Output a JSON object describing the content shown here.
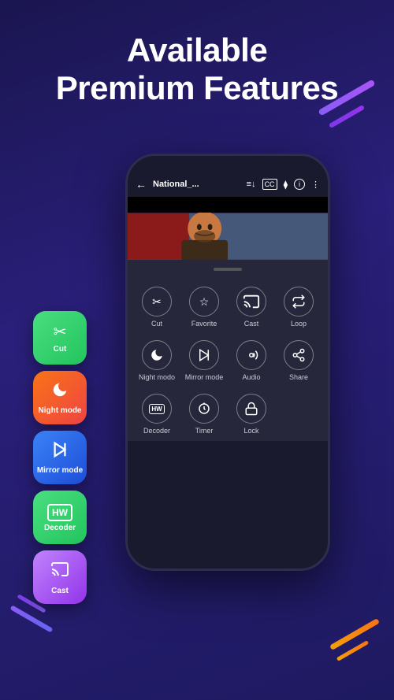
{
  "page": {
    "title_line1": "Available",
    "title_line2": "Premium Features",
    "background_gradient_start": "#1a1650",
    "background_gradient_end": "#1e1a60"
  },
  "phone": {
    "topbar": {
      "title": "National_...",
      "back_icon": "←"
    },
    "features_row1": [
      {
        "label": "Cut",
        "icon": "✂"
      },
      {
        "label": "Favorite",
        "icon": "☆"
      },
      {
        "label": "Cast",
        "icon": "cast"
      },
      {
        "label": "Loop",
        "icon": "↻"
      }
    ],
    "features_row2": [
      {
        "label": "Night modo",
        "icon": "moon"
      },
      {
        "label": "Mirror mode",
        "icon": "mirror"
      },
      {
        "label": "Audio",
        "icon": "♪"
      },
      {
        "label": "Share",
        "icon": "share"
      }
    ],
    "features_row3": [
      {
        "label": "Decoder",
        "icon": "HW"
      },
      {
        "label": "Timer",
        "icon": "⏱"
      },
      {
        "label": "Lock",
        "icon": "🔒"
      },
      {
        "label": "",
        "icon": ""
      }
    ]
  },
  "sidebar_buttons": [
    {
      "label": "Cut",
      "type": "cut",
      "icon": "✂"
    },
    {
      "label": "Night mode",
      "type": "night",
      "icon": "moon"
    },
    {
      "label": "Mirror mode",
      "type": "mirror",
      "icon": "mirror"
    },
    {
      "label": "Decoder",
      "type": "decoder",
      "icon": "HW"
    },
    {
      "label": "Cast",
      "type": "cast",
      "icon": "cast"
    }
  ]
}
